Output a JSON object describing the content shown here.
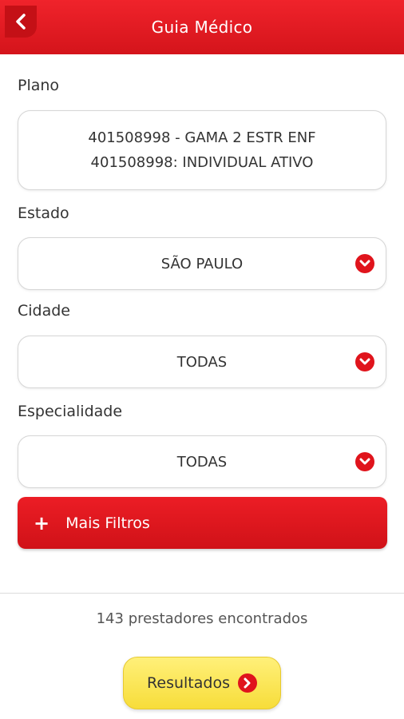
{
  "header": {
    "title": "Guia Médico",
    "back_icon": "chevron-left-icon"
  },
  "plano": {
    "label": "Plano",
    "line1": "401508998 - GAMA 2 ESTR ENF",
    "line2": "401508998: INDIVIDUAL ATIVO"
  },
  "estado": {
    "label": "Estado",
    "value": "SÃO PAULO"
  },
  "cidade": {
    "label": "Cidade",
    "value": "TODAS"
  },
  "especialidade": {
    "label": "Especialidade",
    "value": "TODAS"
  },
  "mais_filtros": {
    "icon": "+",
    "label": "Mais Filtros"
  },
  "results": {
    "count_text": "143 prestadores encontrados",
    "button_label": "Resultados"
  },
  "colors": {
    "primary": "#e0141c",
    "accent_yellow": "#f9e34a"
  }
}
